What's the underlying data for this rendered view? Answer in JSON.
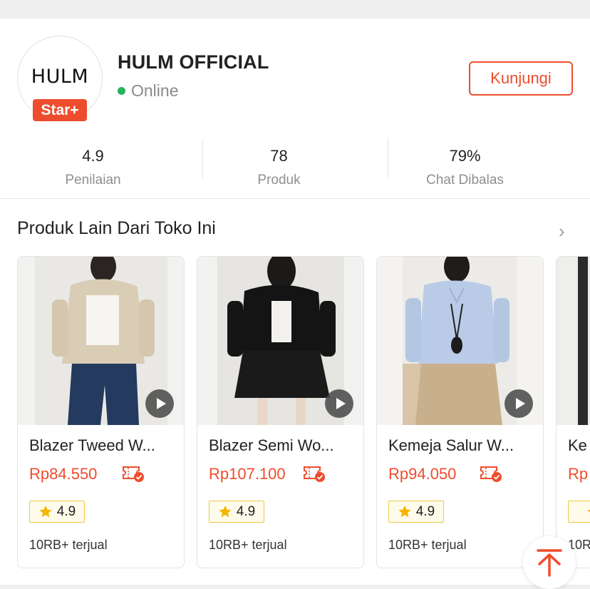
{
  "shop": {
    "logo_text": "HULM",
    "badge": "Star+",
    "name": "HULM OFFICIAL",
    "status": "Online",
    "visit_label": "Kunjungi"
  },
  "stats": [
    {
      "value": "4.9",
      "label": "Penilaian"
    },
    {
      "value": "78",
      "label": "Produk"
    },
    {
      "value": "79%",
      "label": "Chat Dibalas"
    }
  ],
  "section": {
    "title": "Produk Lain Dari Toko Ini"
  },
  "products": [
    {
      "name": "Blazer Tweed W...",
      "price": "Rp84.550",
      "rating": "4.9",
      "sold": "10RB+ terjual"
    },
    {
      "name": "Blazer Semi Wo...",
      "price": "Rp107.100",
      "rating": "4.9",
      "sold": "10RB+ terjual"
    },
    {
      "name": "Kemeja Salur W...",
      "price": "Rp94.050",
      "rating": "4.9",
      "sold": "10RB+ terjual"
    },
    {
      "name": "Ke",
      "price": "Rp",
      "rating": "",
      "sold": "10R"
    }
  ],
  "colors": {
    "accent": "#ee4d2d",
    "online": "#27b35a",
    "rating_border": "#e9c84a",
    "star": "#f5b400"
  },
  "icons": {
    "play": "play-icon",
    "voucher": "voucher-check-icon",
    "star": "star-icon",
    "chevron": "chevron-right-icon",
    "scroll_top": "arrow-up-to-top-icon"
  }
}
